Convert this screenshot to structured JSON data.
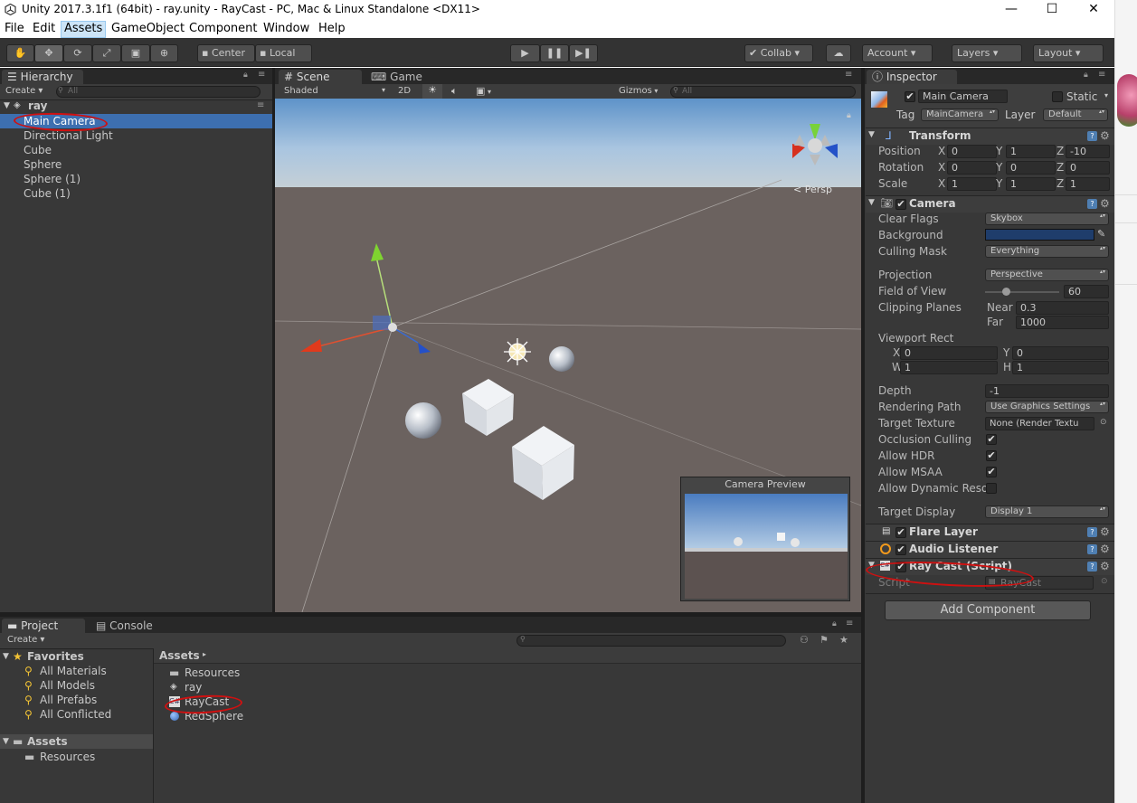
{
  "window": {
    "title": "Unity 2017.3.1f1 (64bit) - ray.unity - RayCast - PC, Mac & Linux Standalone <DX11>",
    "min_glyph": "—",
    "max_glyph": "☐",
    "close_glyph": "✕"
  },
  "menu": {
    "items": [
      "File",
      "Edit",
      "Assets",
      "GameObject",
      "Component",
      "Window",
      "Help"
    ],
    "selected": "Assets"
  },
  "toolbar": {
    "pivot": "Center",
    "space": "Local",
    "collab": "Collab",
    "account": "Account",
    "layers": "Layers",
    "layout": "Layout",
    "tools": [
      "hand-tool",
      "move-tool",
      "rotate-tool",
      "scale-tool",
      "rect-tool",
      "transform-tool"
    ]
  },
  "hierarchy": {
    "tab": "Hierarchy",
    "create": "Create",
    "search_placeholder": "All",
    "scene": "ray",
    "items": [
      "Main Camera",
      "Directional Light",
      "Cube",
      "Sphere",
      "Sphere (1)",
      "Cube (1)"
    ],
    "selected": "Main Camera"
  },
  "scene": {
    "tab_scene": "Scene",
    "tab_game": "Game",
    "shading": "Shaded",
    "mode_2d": "2D",
    "gizmos": "Gizmos",
    "search_placeholder": "All",
    "persp": "Persp",
    "preview_title": "Camera Preview"
  },
  "project": {
    "tab_project": "Project",
    "tab_console": "Console",
    "create": "Create",
    "favorites_label": "Favorites",
    "favorites": [
      "All Materials",
      "All Models",
      "All Prefabs",
      "All Conflicted"
    ],
    "assets_label": "Assets",
    "assets_tree": [
      "Resources"
    ],
    "breadcrumb": "Assets",
    "files": [
      {
        "name": "Resources",
        "icon": "folder-icon"
      },
      {
        "name": "ray",
        "icon": "unity-scene-icon"
      },
      {
        "name": "RayCast",
        "icon": "csharp-script-icon"
      },
      {
        "name": "RedSphere",
        "icon": "material-sphere-icon"
      }
    ]
  },
  "inspector": {
    "tab": "Inspector",
    "object_name": "Main Camera",
    "static_label": "Static",
    "tag_label": "Tag",
    "tag_value": "MainCamera",
    "layer_label": "Layer",
    "layer_value": "Default",
    "transform": {
      "title": "Transform",
      "rows": [
        {
          "label": "Position",
          "x": "0",
          "y": "1",
          "z": "-10"
        },
        {
          "label": "Rotation",
          "x": "0",
          "y": "0",
          "z": "0"
        },
        {
          "label": "Scale",
          "x": "1",
          "y": "1",
          "z": "1"
        }
      ],
      "axis_x": "X",
      "axis_y": "Y",
      "axis_z": "Z"
    },
    "camera": {
      "title": "Camera",
      "clear_flags_label": "Clear Flags",
      "clear_flags": "Skybox",
      "background_label": "Background",
      "background_color": "#1f3d6b",
      "culling_mask_label": "Culling Mask",
      "culling_mask": "Everything",
      "projection_label": "Projection",
      "projection": "Perspective",
      "fov_label": "Field of View",
      "fov": "60",
      "fov_fraction": 0.28,
      "clipping_label": "Clipping Planes",
      "near_label": "Near",
      "near": "0.3",
      "far_label": "Far",
      "far": "1000",
      "viewport_label": "Viewport Rect",
      "vp_x_label": "X",
      "vp_x": "0",
      "vp_y_label": "Y",
      "vp_y": "0",
      "vp_w_label": "W",
      "vp_w": "1",
      "vp_h_label": "H",
      "vp_h": "1",
      "depth_label": "Depth",
      "depth": "-1",
      "rendering_path_label": "Rendering Path",
      "rendering_path": "Use Graphics Settings",
      "target_texture_label": "Target Texture",
      "target_texture": "None (Render Textu",
      "occlusion_label": "Occlusion Culling",
      "occlusion": true,
      "hdr_label": "Allow HDR",
      "hdr": true,
      "msaa_label": "Allow MSAA",
      "msaa": true,
      "dynres_label": "Allow Dynamic Reso",
      "dynres": false,
      "target_display_label": "Target Display",
      "target_display": "Display 1"
    },
    "flare_layer": "Flare Layer",
    "audio_listener": "Audio Listener",
    "raycast": {
      "title": "Ray Cast (Script)",
      "script_label": "Script",
      "script_value": "RayCast"
    },
    "add_component": "Add Component"
  },
  "colors": {
    "selection": "#3d6fb0",
    "scene_ground": "#6b625f",
    "annotation_red": "#d01010"
  }
}
